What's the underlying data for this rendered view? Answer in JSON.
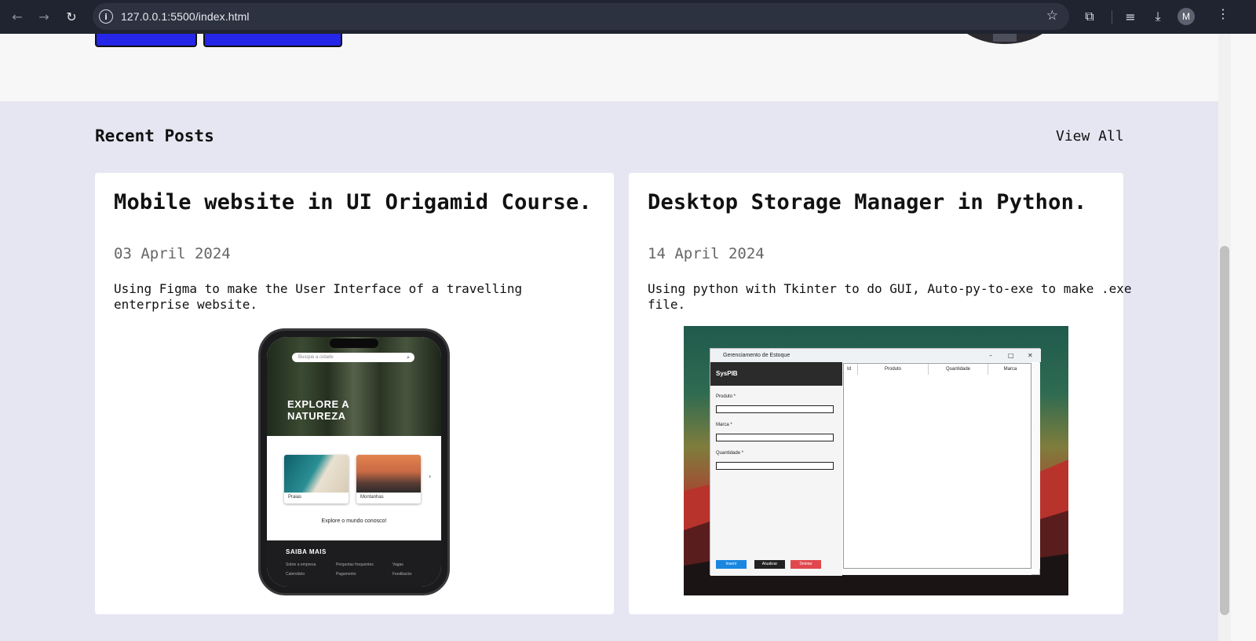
{
  "browser": {
    "url": "127.0.0.1:5500/index.html",
    "profile_initial": "M",
    "icons": {
      "back": "back-arrow-icon",
      "forward": "forward-arrow-icon",
      "reload": "reload-icon",
      "site_info": "info-icon",
      "bookmark": "star-icon",
      "extensions": "puzzle-icon",
      "media": "media-controls-icon",
      "downloads": "download-icon",
      "menu": "kebab-menu-icon"
    }
  },
  "posts": {
    "section_title": "Recent Posts",
    "view_all_label": "View All",
    "items": [
      {
        "title": "Mobile website in UI Origamid Course.",
        "date": "03 April 2024",
        "description": "Using Figma to make the User Interface of a travelling enterprise website.",
        "image": {
          "search_placeholder": "Busque a cidade",
          "hero_text": "EXPLORE A NATUREZA",
          "cards": [
            "Praias",
            "Montanhas"
          ],
          "tagline": "Explore o mundo conosco!",
          "footer_title": "SAIBA MAIS",
          "footer_links": [
            "Sobre a empresa",
            "Perguntas frequentes",
            "Vagas",
            "Calendário",
            "Pagamento",
            "Feedbacks"
          ]
        }
      },
      {
        "title": "Desktop Storage Manager in Python.",
        "date": "14 April 2024",
        "description": "Using python with Tkinter to do GUI, Auto-py-to-exe to make .exe file.",
        "image": {
          "window_title": "Gerenciamento de Estoque",
          "app_name": "SysPIB",
          "fields": [
            "Produto *",
            "Marca *",
            "Quantidade *"
          ],
          "columns": [
            "Id",
            "Produto",
            "Quantidade",
            "Marca"
          ],
          "buttons": [
            "Inserir",
            "Atualizar",
            "Deletar"
          ]
        }
      }
    ]
  },
  "colors": {
    "hero_button": "#2626e8",
    "section_bg": "#e6e6f3",
    "chrome_bg": "#1f2430"
  }
}
